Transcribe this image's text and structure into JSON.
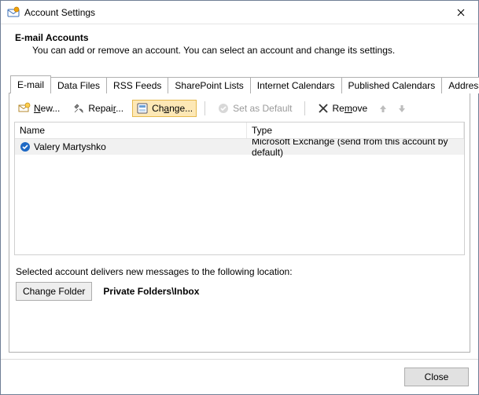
{
  "window": {
    "title": "Account Settings"
  },
  "header": {
    "title": "E-mail Accounts",
    "description": "You can add or remove an account. You can select an account and change its settings."
  },
  "tabs": [
    {
      "label": "E-mail",
      "active": true
    },
    {
      "label": "Data Files",
      "active": false
    },
    {
      "label": "RSS Feeds",
      "active": false
    },
    {
      "label": "SharePoint Lists",
      "active": false
    },
    {
      "label": "Internet Calendars",
      "active": false
    },
    {
      "label": "Published Calendars",
      "active": false
    },
    {
      "label": "Address Books",
      "active": false
    }
  ],
  "toolbar": {
    "new": "New...",
    "repair": "Repair...",
    "change": "Change...",
    "set_default": "Set as Default",
    "remove": "Remove"
  },
  "grid": {
    "columns": {
      "name": "Name",
      "type": "Type"
    },
    "rows": [
      {
        "name": "Valery Martyshko",
        "type": "Microsoft Exchange (send from this account by default)",
        "default": true
      }
    ]
  },
  "delivery": {
    "text": "Selected account delivers new messages to the following location:",
    "button": "Change Folder",
    "path": "Private Folders\\Inbox"
  },
  "footer": {
    "close": "Close"
  }
}
